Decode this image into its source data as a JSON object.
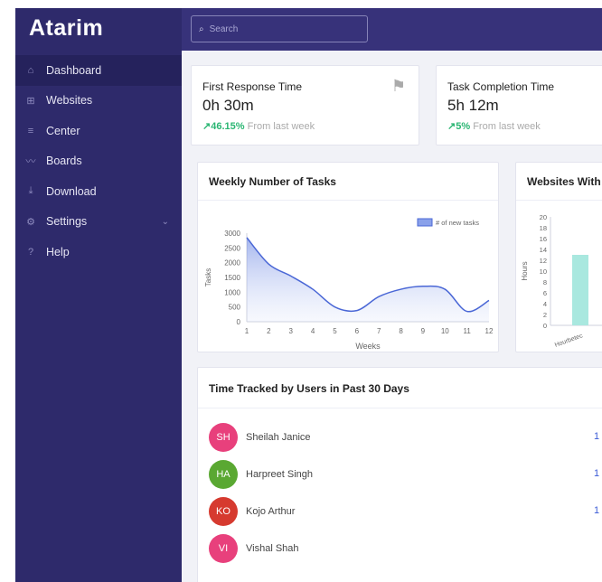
{
  "brand": {
    "logo": "Atarim"
  },
  "search": {
    "placeholder": "Search"
  },
  "sidebar": {
    "items": [
      {
        "label": "Dashboard",
        "icon": "home-icon"
      },
      {
        "label": "Websites",
        "icon": "grid-icon"
      },
      {
        "label": "Center",
        "icon": "list-icon"
      },
      {
        "label": "Boards",
        "icon": "wave-icon"
      },
      {
        "label": "Download",
        "icon": "download-icon"
      },
      {
        "label": "Settings",
        "icon": "gear-icon"
      },
      {
        "label": "Help",
        "icon": "help-icon"
      }
    ]
  },
  "stats": {
    "first_response": {
      "title": "First Response Time",
      "value": "0h 30m",
      "trend": "46.15%",
      "trend_text": "From last week"
    },
    "task_completion": {
      "title": "Task Completion Time",
      "value": "5h 12m",
      "trend": "5%",
      "trend_text": "From last week"
    }
  },
  "weekly_tasks": {
    "title": "Weekly Number of Tasks"
  },
  "websites_card": {
    "title": "Websites With"
  },
  "time_tracked": {
    "title": "Time Tracked by Users in Past 30 Days",
    "users": [
      {
        "initials": "SH",
        "name": "Sheilah Janice",
        "value": "1",
        "color": "#e8407c"
      },
      {
        "initials": "HA",
        "name": "Harpreet Singh",
        "value": "1",
        "color": "#5aa832"
      },
      {
        "initials": "KO",
        "name": "Kojo Arthur",
        "value": "1",
        "color": "#d63a2f"
      },
      {
        "initials": "VI",
        "name": "Vishal Shah",
        "value": "",
        "color": "#e8407c"
      }
    ]
  },
  "chart_data": [
    {
      "type": "area",
      "title": "Weekly Number of Tasks",
      "xlabel": "Weeks",
      "ylabel": "Tasks",
      "legend": "# of new tasks",
      "legend_position": "top-right",
      "x": [
        1,
        2,
        3,
        4,
        5,
        6,
        7,
        8,
        9,
        10,
        11,
        12
      ],
      "values": [
        2850,
        1950,
        1550,
        1100,
        500,
        380,
        850,
        1100,
        1200,
        1100,
        350,
        720
      ],
      "yticks": [
        0,
        500,
        1000,
        1500,
        2000,
        2500,
        3000
      ],
      "ylim": [
        0,
        3000
      ],
      "color": "#4a67d6"
    },
    {
      "type": "bar",
      "title": "Websites With",
      "ylabel": "Hours",
      "categories": [
        "Hourbetec"
      ],
      "values": [
        13
      ],
      "yticks": [
        0,
        2,
        4,
        6,
        8,
        10,
        12,
        14,
        16,
        18,
        20
      ],
      "ylim": [
        0,
        20
      ],
      "color": "#a9e8df"
    }
  ]
}
